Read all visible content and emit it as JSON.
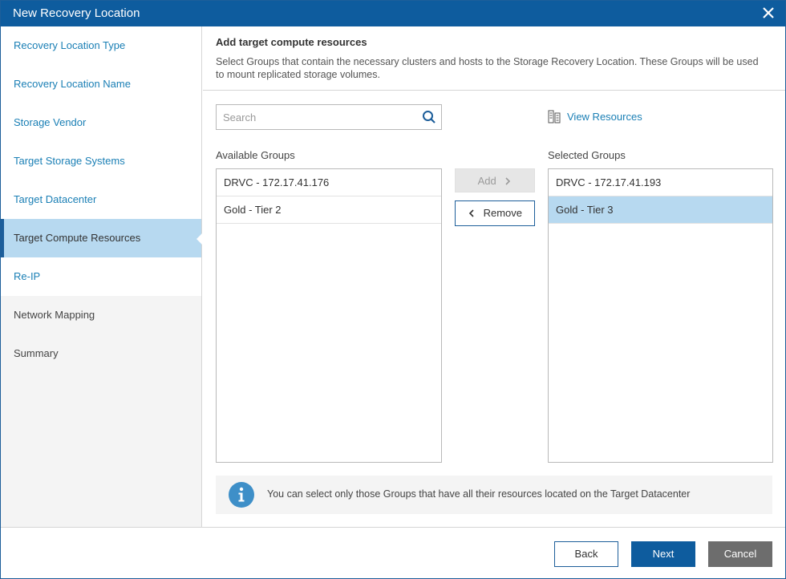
{
  "window": {
    "title": "New Recovery Location"
  },
  "sidebar": {
    "items": [
      {
        "label": "Recovery Location Type",
        "state": "done"
      },
      {
        "label": "Recovery Location Name",
        "state": "done"
      },
      {
        "label": "Storage Vendor",
        "state": "done"
      },
      {
        "label": "Target Storage Systems",
        "state": "done"
      },
      {
        "label": "Target Datacenter",
        "state": "done"
      },
      {
        "label": "Target Compute Resources",
        "state": "active"
      },
      {
        "label": "Re-IP",
        "state": "done"
      },
      {
        "label": "Network Mapping",
        "state": "todo"
      },
      {
        "label": "Summary",
        "state": "todo"
      }
    ]
  },
  "main": {
    "title": "Add target compute resources",
    "description": "Select Groups that contain the necessary clusters and hosts to the Storage Recovery Location. These Groups will be used to mount replicated storage volumes.",
    "search": {
      "placeholder": "Search",
      "value": ""
    },
    "view_resources_label": "View Resources",
    "available": {
      "label": "Available Groups",
      "items": [
        "DRVC - 172.17.41.176",
        "Gold - Tier 2"
      ]
    },
    "selected": {
      "label": "Selected Groups",
      "items": [
        "DRVC - 172.17.41.193",
        "Gold - Tier 3"
      ],
      "highlighted_index": 1
    },
    "add_label": "Add",
    "remove_label": "Remove",
    "info_text": "You can select only those Groups that have all their resources located on the Target Datacenter"
  },
  "footer": {
    "back_label": "Back",
    "next_label": "Next",
    "cancel_label": "Cancel"
  },
  "colors": {
    "title_bar": "#0e5c9e",
    "link": "#1a7fb5",
    "selection": "#b7d9f0",
    "info_icon": "#3e8fc8"
  },
  "icons": {
    "close": "close-icon",
    "search": "search-icon",
    "view_resources": "server-icon",
    "info": "info-icon"
  }
}
